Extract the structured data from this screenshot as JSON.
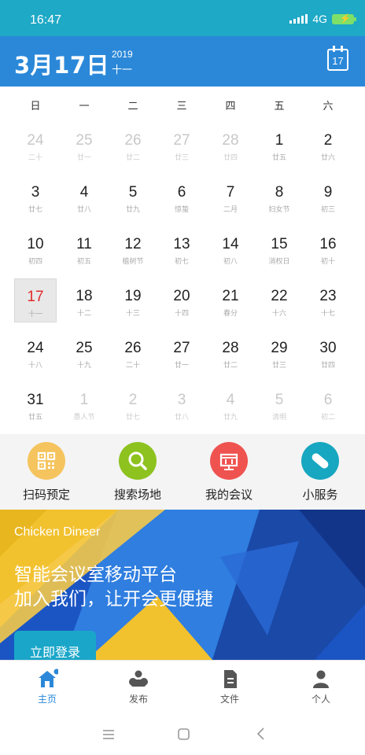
{
  "status": {
    "time": "16:47",
    "network": "4G"
  },
  "header": {
    "date": "3月17日",
    "year": "2019",
    "lunar": "十一",
    "calendar_icon_day": "17"
  },
  "weekdays": [
    "日",
    "一",
    "二",
    "三",
    "四",
    "五",
    "六"
  ],
  "calendar": [
    [
      {
        "d": "24",
        "l": "二十",
        "out": true
      },
      {
        "d": "25",
        "l": "廿一",
        "out": true
      },
      {
        "d": "26",
        "l": "廿二",
        "out": true
      },
      {
        "d": "27",
        "l": "廿三",
        "out": true
      },
      {
        "d": "28",
        "l": "廿四",
        "out": true
      },
      {
        "d": "1",
        "l": "廿五"
      },
      {
        "d": "2",
        "l": "廿六"
      }
    ],
    [
      {
        "d": "3",
        "l": "廿七"
      },
      {
        "d": "4",
        "l": "廿八"
      },
      {
        "d": "5",
        "l": "廿九"
      },
      {
        "d": "6",
        "l": "惊蛰"
      },
      {
        "d": "7",
        "l": "二月"
      },
      {
        "d": "8",
        "l": "妇女节"
      },
      {
        "d": "9",
        "l": "初三"
      }
    ],
    [
      {
        "d": "10",
        "l": "初四"
      },
      {
        "d": "11",
        "l": "初五"
      },
      {
        "d": "12",
        "l": "植树节"
      },
      {
        "d": "13",
        "l": "初七"
      },
      {
        "d": "14",
        "l": "初八"
      },
      {
        "d": "15",
        "l": "消权日"
      },
      {
        "d": "16",
        "l": "初十"
      }
    ],
    [
      {
        "d": "17",
        "l": "十一",
        "today": true
      },
      {
        "d": "18",
        "l": "十二"
      },
      {
        "d": "19",
        "l": "十三"
      },
      {
        "d": "20",
        "l": "十四"
      },
      {
        "d": "21",
        "l": "春分"
      },
      {
        "d": "22",
        "l": "十六"
      },
      {
        "d": "23",
        "l": "十七"
      }
    ],
    [
      {
        "d": "24",
        "l": "十八"
      },
      {
        "d": "25",
        "l": "十九"
      },
      {
        "d": "26",
        "l": "二十"
      },
      {
        "d": "27",
        "l": "廿一"
      },
      {
        "d": "28",
        "l": "廿二"
      },
      {
        "d": "29",
        "l": "廿三"
      },
      {
        "d": "30",
        "l": "廿四"
      }
    ],
    [
      {
        "d": "31",
        "l": "廿五"
      },
      {
        "d": "1",
        "l": "愚人节",
        "out": true
      },
      {
        "d": "2",
        "l": "廿七",
        "out": true
      },
      {
        "d": "3",
        "l": "廿八",
        "out": true
      },
      {
        "d": "4",
        "l": "廿九",
        "out": true
      },
      {
        "d": "5",
        "l": "清明",
        "out": true
      },
      {
        "d": "6",
        "l": "初二",
        "out": true
      }
    ]
  ],
  "services": [
    {
      "label": "扫码预定",
      "icon": "qr-code-icon",
      "color": "#f5c45e"
    },
    {
      "label": "搜索场地",
      "icon": "search-icon",
      "color": "#8dc21f"
    },
    {
      "label": "我的会议",
      "icon": "meeting-icon",
      "color": "#ef5350"
    },
    {
      "label": "小服务",
      "icon": "pill-icon",
      "color": "#17a7c0"
    }
  ],
  "banner": {
    "tag": "Chicken Dineer",
    "line1": "智能会议室移动平台",
    "line2": "加入我们，让开会更便捷",
    "button": "立即登录"
  },
  "bottom_nav": [
    {
      "label": "主页",
      "icon": "home-icon",
      "active": true
    },
    {
      "label": "发布",
      "icon": "publish-icon"
    },
    {
      "label": "文件",
      "icon": "file-icon"
    },
    {
      "label": "个人",
      "icon": "person-icon"
    }
  ],
  "colors": {
    "statusbar": "#1ea9c6",
    "header": "#2b88d9",
    "today_text": "#e02b2b",
    "nav_active": "#2b88d9"
  }
}
